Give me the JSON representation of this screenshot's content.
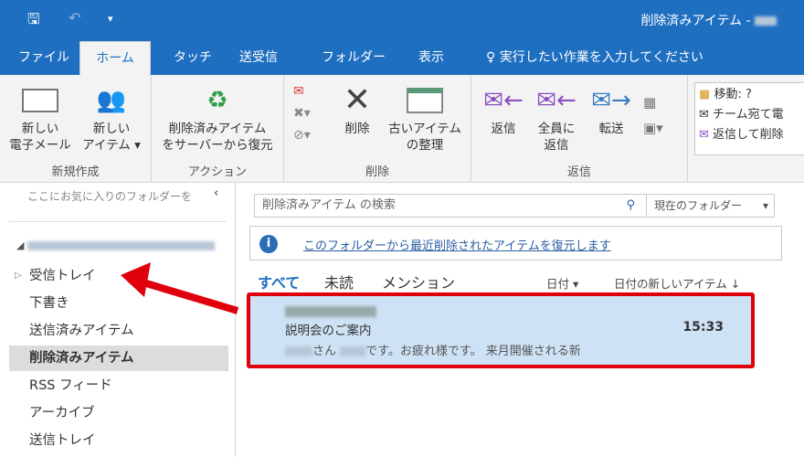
{
  "titlebar": {
    "title": "削除済みアイテム -"
  },
  "tabs": [
    "ファイル",
    "ホーム",
    "タッチ",
    "送受信",
    "フォルダー",
    "表示"
  ],
  "tell_me": "実行したい作業を入力してください",
  "ribbon": {
    "new_group": {
      "label": "新規作成",
      "new_mail": "新しい\n電子メール",
      "new_item": "新しい\nアイテム ▾"
    },
    "action_group": {
      "label": "アクション",
      "recover": "削除済みアイテム\nをサーバーから復元"
    },
    "delete_group": {
      "label": "削除",
      "delete": "削除",
      "cleanup": "古いアイテム\nの整理"
    },
    "reply_group": {
      "label": "返信",
      "reply": "返信",
      "reply_all": "全員に\n返信",
      "forward": "転送"
    },
    "quick_steps": [
      "移動: ?",
      "チーム宛て電",
      "返信して削除"
    ]
  },
  "left": {
    "favorites_hint": "ここにお気に入りのフォルダーを",
    "folders": [
      "受信トレイ",
      "下書き",
      "送信済みアイテム",
      "削除済みアイテム",
      "RSS フィード",
      "アーカイブ",
      "送信トレイ"
    ]
  },
  "search": {
    "placeholder": "削除済みアイテム の検索",
    "scope": "現在のフォルダー"
  },
  "info": {
    "link": "このフォルダーから最近削除されたアイテムを復元します"
  },
  "filters": {
    "all": "すべて",
    "unread": "未読",
    "mentions": "メンション",
    "sort_by": "日付 ▾",
    "order": "日付の新しいアイテム ↓"
  },
  "message": {
    "subject": "説明会のご案内",
    "time": "15:33",
    "preview_a": "さん",
    "preview_b": "です。お疲れ様です。 来月開催される新"
  },
  "colors": {
    "accent": "#1f6fc1",
    "highlight": "#e0000b",
    "selected": "#cde2f4"
  }
}
